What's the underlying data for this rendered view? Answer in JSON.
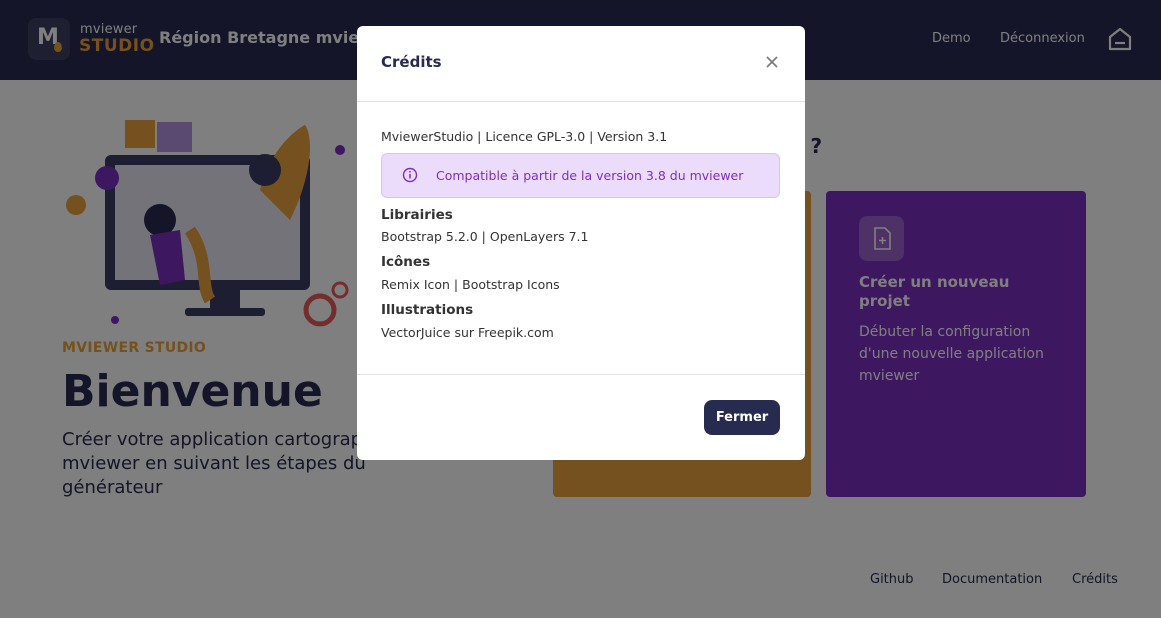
{
  "header": {
    "logo_line1": "mviewer",
    "logo_line2": "STUDIO",
    "app_title": "Région Bretagne mviewer",
    "nav": [
      {
        "label": "Demo"
      },
      {
        "label": "Déconnexion"
      }
    ],
    "home_icon": "home-icon"
  },
  "main": {
    "brand_label": "MVIEWER STUDIO",
    "welcome_title": "Bienvenue",
    "intro_text": "Créer votre application cartographique mviewer en suivant les étapes du générateur",
    "question_fragment": "e ?",
    "card_new": {
      "title": "Créer un nouveau projet",
      "description": "Débuter la configuration d'une nouvelle application mviewer",
      "icon": "file-add-icon"
    }
  },
  "footer": {
    "links": [
      {
        "label": "Github"
      },
      {
        "label": "Documentation"
      },
      {
        "label": "Crédits"
      }
    ]
  },
  "modal": {
    "title": "Crédits",
    "close_icon": "close-icon",
    "license_line": "MviewerStudio | Licence GPL-3.0 | Version 3.1",
    "alert_text": "Compatible à partir de la version 3.8 du mviewer",
    "sections": [
      {
        "heading": "Librairies",
        "text": "Bootstrap 5.2.0 | OpenLayers 7.1"
      },
      {
        "heading": "Icônes",
        "text": "Remix Icon | Bootstrap Icons"
      },
      {
        "heading": "Illustrations",
        "text": "VectorJuice sur Freepik.com"
      }
    ],
    "close_button": "Fermer"
  },
  "colors": {
    "navy": "#282b50",
    "orange": "#e8a33c",
    "purple": "#7b2fbf",
    "alert_bg": "#ecdcfb"
  }
}
